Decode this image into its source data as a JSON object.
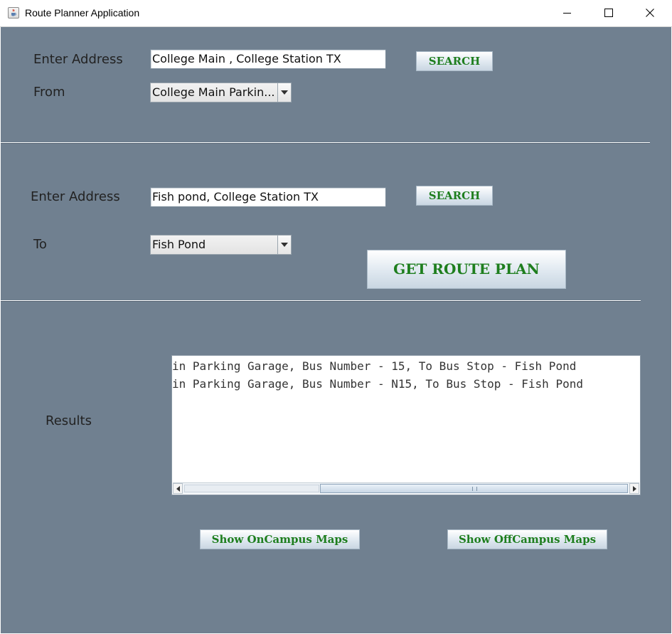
{
  "window": {
    "title": "Route Planner Application"
  },
  "from_section": {
    "address_label": "Enter Address",
    "address_value": "College Main , College Station TX",
    "search_label": "SEARCH",
    "combo_label": "From",
    "combo_value": "College Main Parkin..."
  },
  "to_section": {
    "address_label": "Enter Address",
    "address_value": "Fish pond, College Station TX",
    "search_label": "SEARCH",
    "combo_label": "To",
    "combo_value": "Fish Pond",
    "route_button": "GET ROUTE PLAN"
  },
  "results": {
    "label": "Results",
    "lines": [
      "in Parking Garage, Bus Number - 15, To Bus Stop - Fish Pond",
      "in Parking Garage, Bus Number - N15, To Bus Stop - Fish Pond"
    ]
  },
  "buttons": {
    "oncampus": "Show OnCampus Maps",
    "offcampus": "Show OffCampus Maps"
  },
  "colors": {
    "panel_background": "#708090",
    "button_text": "#1e7e1e"
  },
  "icons": {
    "app": "java-cup-icon",
    "minimize": "minimize-icon",
    "maximize": "maximize-icon",
    "close": "close-icon",
    "dropdown": "chevron-down-icon"
  }
}
